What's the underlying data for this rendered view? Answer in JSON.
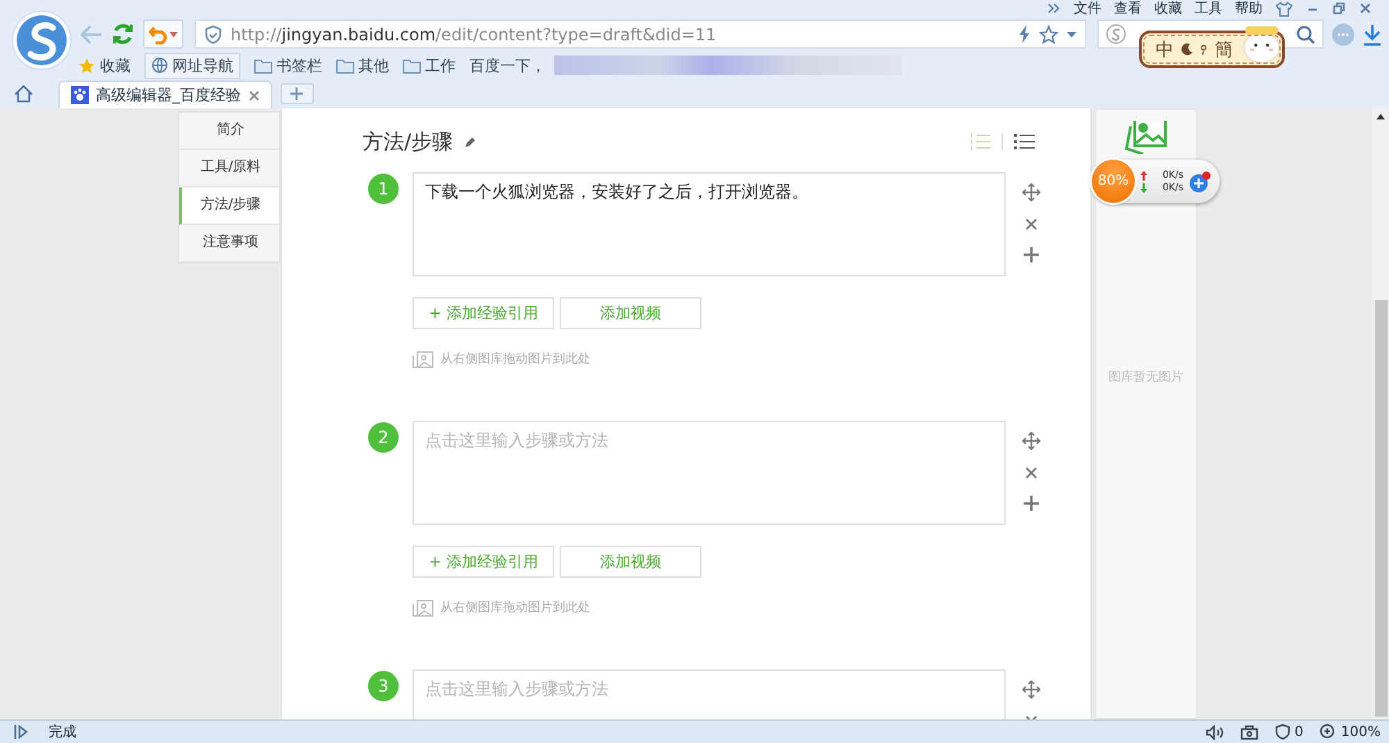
{
  "window": {
    "menu": [
      "文件",
      "查看",
      "收藏",
      "工具",
      "帮助"
    ]
  },
  "address_bar": {
    "url": "http://**jingyan.baidu.com**/edit/content?type=draft&did=11"
  },
  "bookmarks": [
    {
      "label": "收藏",
      "kind": "star"
    },
    {
      "label": "网址导航",
      "kind": "globe"
    },
    {
      "label": "书签栏",
      "kind": "folder"
    },
    {
      "label": "其他",
      "kind": "folder"
    },
    {
      "label": "工作",
      "kind": "folder"
    },
    {
      "label": "百度一下，",
      "kind": "page"
    }
  ],
  "tabs": [
    {
      "label": "高级编辑器_百度经验",
      "selected": true
    }
  ],
  "ime_badge": {
    "left": "中",
    "right": "簡"
  },
  "sidebar": {
    "items": [
      {
        "label": "简介",
        "selected": false
      },
      {
        "label": "工具/原料",
        "selected": false
      },
      {
        "label": "方法/步骤",
        "selected": true
      },
      {
        "label": "注意事项",
        "selected": false
      }
    ]
  },
  "section": {
    "title": "方法/步骤"
  },
  "steps": [
    {
      "number": "1",
      "text": "下载一个火狐浏览器，安装好了之后，打开浏览器。",
      "buttons": [
        "+ 添加经验引用",
        "添加视频"
      ],
      "hint": "从右侧图库拖动图片到此处"
    },
    {
      "number": "2",
      "placeholder": "点击这里输入步骤或方法",
      "buttons": [
        "+ 添加经验引用",
        "添加视频"
      ],
      "hint": "从右侧图库拖动图片到此处"
    },
    {
      "number": "3",
      "placeholder": "点击这里输入步骤或方法"
    }
  ],
  "gallery": {
    "empty_text": "图库暂无图片"
  },
  "speed_widget": {
    "percent": "80%",
    "upload": "0K/s",
    "download": "0K/s"
  },
  "status_bar": {
    "text": "完成",
    "shield_count": "0",
    "zoom": "100%"
  }
}
